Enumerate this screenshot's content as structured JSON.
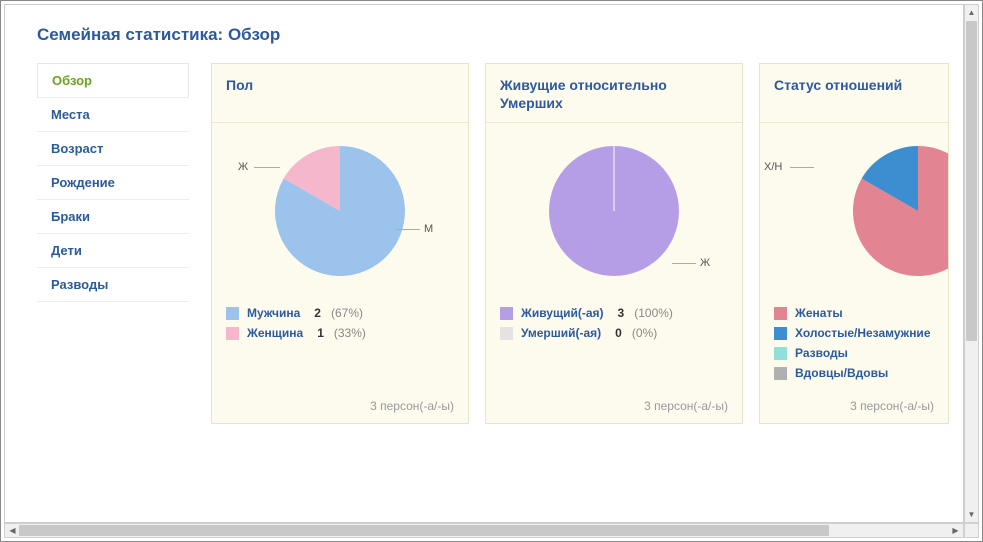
{
  "page_title": "Семейная статистика: Обзор",
  "sidebar": {
    "items": [
      {
        "label": "Обзор",
        "active": true
      },
      {
        "label": "Места",
        "active": false
      },
      {
        "label": "Возраст",
        "active": false
      },
      {
        "label": "Рождение",
        "active": false
      },
      {
        "label": "Браки",
        "active": false
      },
      {
        "label": "Дети",
        "active": false
      },
      {
        "label": "Разводы",
        "active": false
      }
    ]
  },
  "cards": {
    "gender": {
      "title": "Пол",
      "footer": "3 персон(-а/-ы)",
      "labels": {
        "m": "М",
        "f": "Ж"
      },
      "legend": [
        {
          "label": "Мужчина",
          "value": "2",
          "pct": "(67%)",
          "color": "#9cc3ec"
        },
        {
          "label": "Женщина",
          "value": "1",
          "pct": "(33%)",
          "color": "#f4b7cb"
        }
      ]
    },
    "living": {
      "title": "Живущие относительно Умерших",
      "footer": "3 персон(-а/-ы)",
      "labels": {
        "alive": "Ж"
      },
      "legend": [
        {
          "label": "Живущий(-ая)",
          "value": "3",
          "pct": "(100%)",
          "color": "#b69ee6"
        },
        {
          "label": "Умерший(-ая)",
          "value": "0",
          "pct": "(0%)",
          "color": "#e3e3e3"
        }
      ]
    },
    "relationship": {
      "title": "Статус отношений",
      "footer": "3 персон(-а/-ы)",
      "labels": {
        "xn": "Х/Н"
      },
      "legend": [
        {
          "label": "Женаты",
          "color": "#e38493"
        },
        {
          "label": "Холостые/Незамужние",
          "color": "#3d8ed0"
        },
        {
          "label": "Разводы",
          "color": "#8fe0da"
        },
        {
          "label": "Вдовцы/Вдовы",
          "color": "#b0b0b0"
        }
      ]
    }
  },
  "chart_data": [
    {
      "type": "pie",
      "title": "Пол",
      "series": [
        {
          "name": "Мужчина",
          "value": 2,
          "pct": 67,
          "color": "#9cc3ec"
        },
        {
          "name": "Женщина",
          "value": 1,
          "pct": 33,
          "color": "#f4b7cb"
        }
      ],
      "total": 3
    },
    {
      "type": "pie",
      "title": "Живущие относительно Умерших",
      "series": [
        {
          "name": "Живущий(-ая)",
          "value": 3,
          "pct": 100,
          "color": "#b69ee6"
        },
        {
          "name": "Умерший(-ая)",
          "value": 0,
          "pct": 0,
          "color": "#e3e3e3"
        }
      ],
      "total": 3
    },
    {
      "type": "pie",
      "title": "Статус отношений",
      "series": [
        {
          "name": "Женаты",
          "value": 2,
          "pct": 67,
          "color": "#e38493"
        },
        {
          "name": "Холостые/Незамужние",
          "value": 1,
          "pct": 33,
          "color": "#3d8ed0"
        },
        {
          "name": "Разводы",
          "value": 0,
          "pct": 0,
          "color": "#8fe0da"
        },
        {
          "name": "Вдовцы/Вдовы",
          "value": 0,
          "pct": 0,
          "color": "#b0b0b0"
        }
      ],
      "total": 3
    }
  ]
}
